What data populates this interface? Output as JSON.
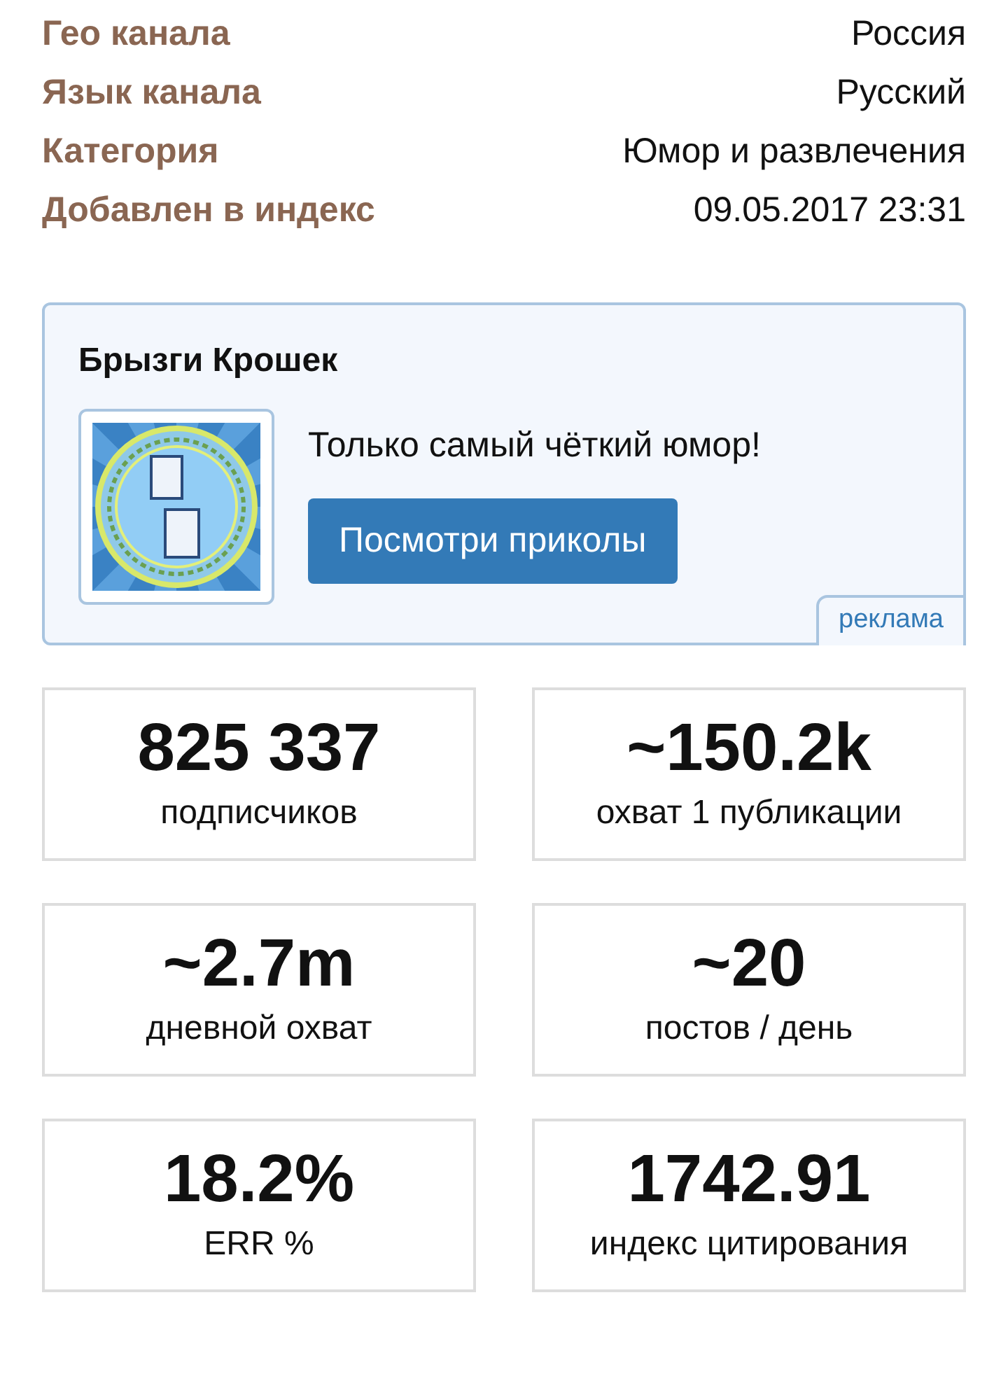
{
  "info": [
    {
      "label": "Гео канала",
      "value": "Россия"
    },
    {
      "label": "Язык канала",
      "value": "Русский"
    },
    {
      "label": "Категория",
      "value": "Юмор и развлечения"
    },
    {
      "label": "Добавлен в индекс",
      "value": "09.05.2017 23:31"
    }
  ],
  "ad": {
    "title": "Брызги Крошек",
    "text": "Только самый чёткий юмор!",
    "button": "Посмотри приколы",
    "tag": "реклама"
  },
  "stats": [
    {
      "value": "825 337",
      "label": "подписчиков"
    },
    {
      "value": "~150.2k",
      "label": "охват 1 публикации"
    },
    {
      "value": "~2.7m",
      "label": "дневной охват"
    },
    {
      "value": "~20",
      "label": "постов / день"
    },
    {
      "value": "18.2%",
      "label": "ERR %"
    },
    {
      "value": "1742.91",
      "label": "индекс цитирования"
    }
  ]
}
